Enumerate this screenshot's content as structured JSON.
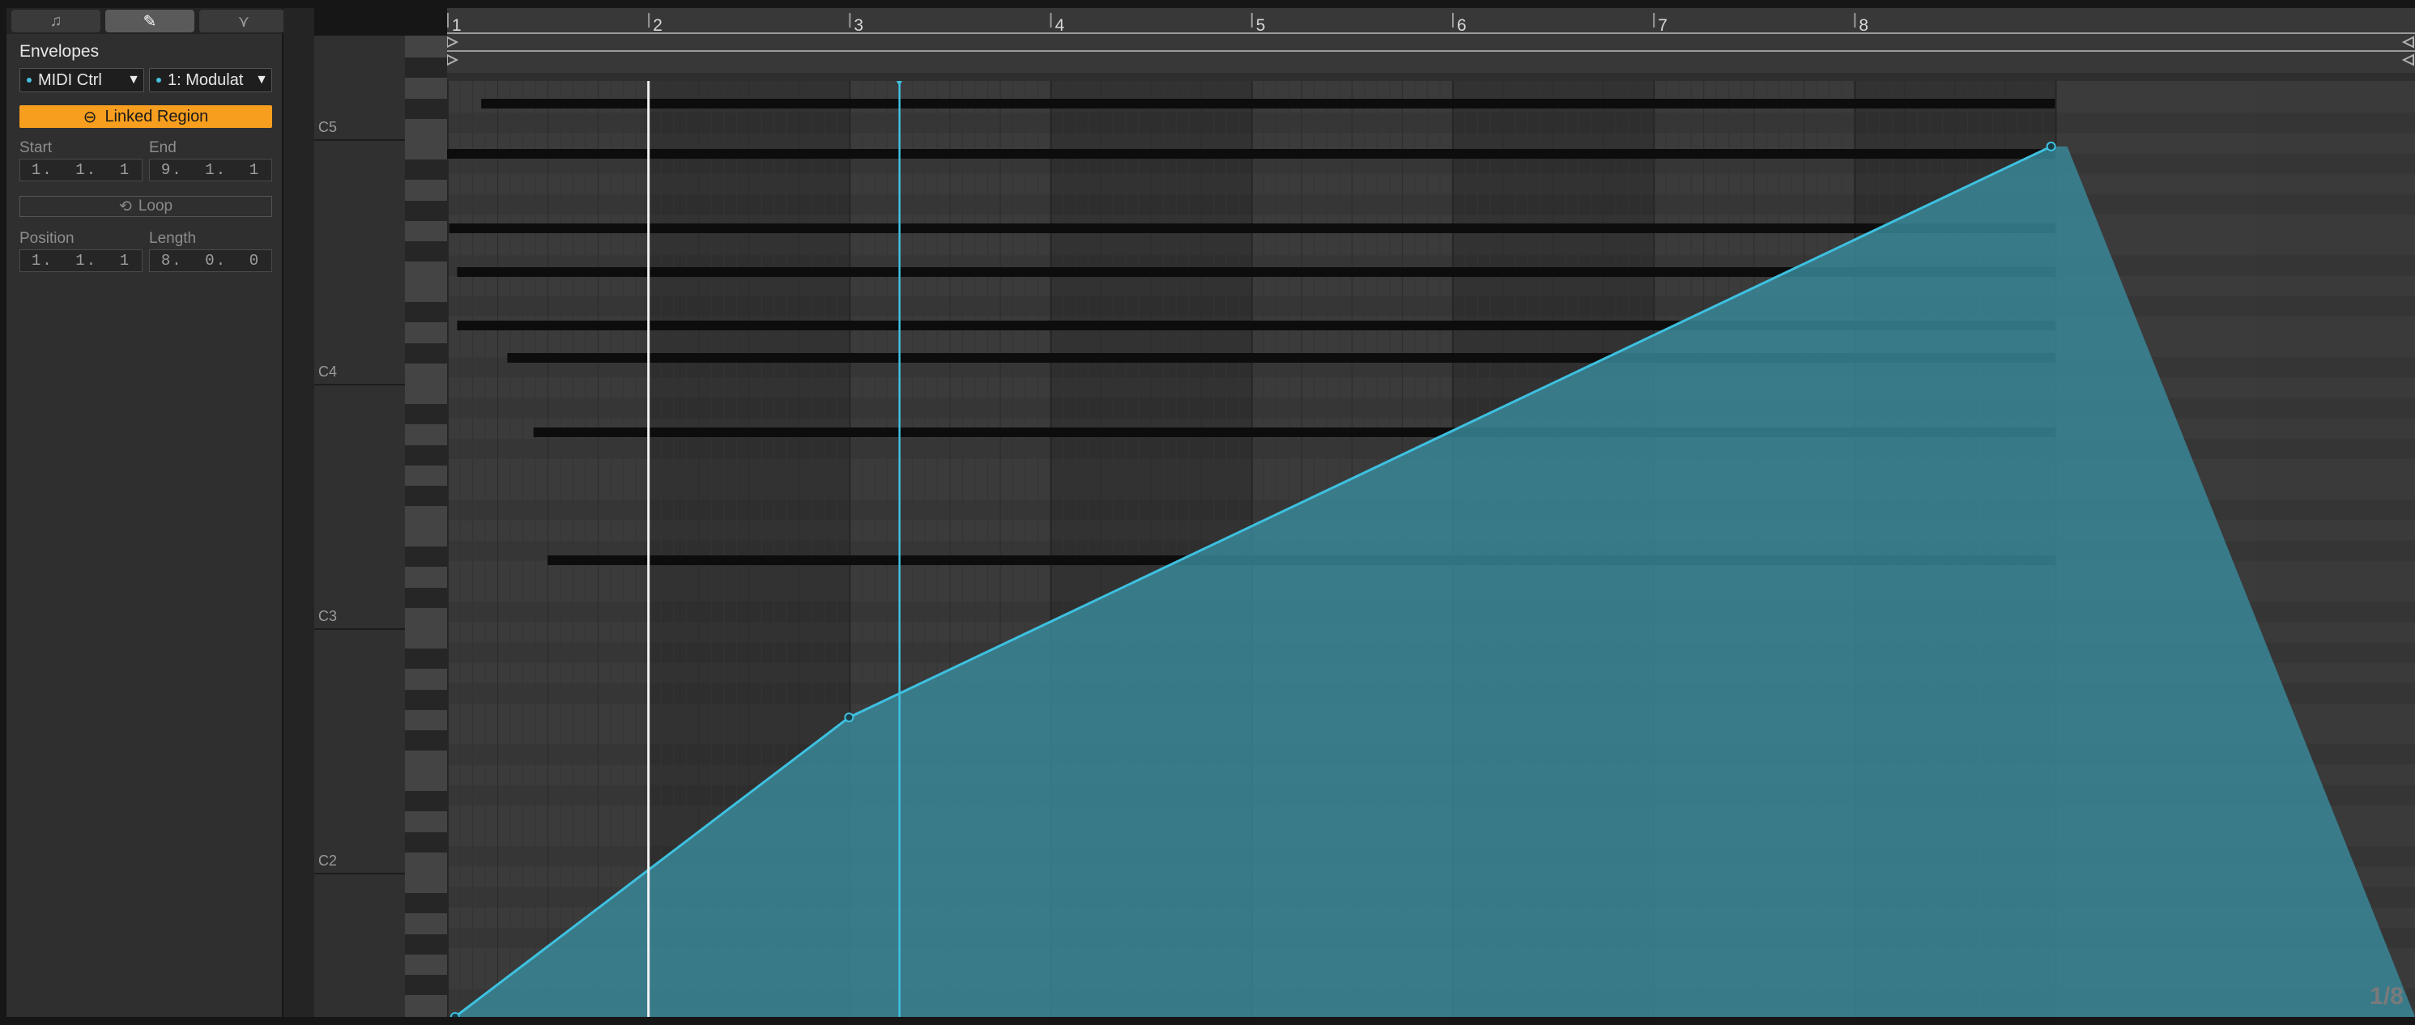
{
  "tabs": [
    {
      "name": "notes-tab",
      "icon": "note-icon",
      "glyph": "♫"
    },
    {
      "name": "envelopes-tab",
      "icon": "envelope-pencil-icon",
      "glyph": "✎"
    },
    {
      "name": "mpe-tab",
      "icon": "mpe-icon",
      "glyph": "⋎"
    }
  ],
  "panel": {
    "title": "Envelopes",
    "device_select": "MIDI Ctrl",
    "control_select": "1: Modulat",
    "linked_label": "Linked Region",
    "start_label": "Start",
    "end_label": "End",
    "start_value": [
      "1.",
      "1.",
      "1"
    ],
    "end_value": [
      "9.",
      "1.",
      "1"
    ],
    "loop_label": "Loop",
    "position_label": "Position",
    "length_label": "Length",
    "position_value": [
      "1.",
      "1.",
      "1"
    ],
    "length_value": [
      "8.",
      "0.",
      "0"
    ]
  },
  "keyboard": {
    "labels": [
      "C5",
      "C4",
      "C3",
      "C2"
    ]
  },
  "ruler": {
    "bars": [
      "1",
      "2",
      "3",
      "4",
      "5",
      "6",
      "7",
      "8"
    ]
  },
  "notes": [
    {
      "start": 1.17,
      "end": 9.0
    },
    {
      "start": 1.0,
      "end": 9.0
    },
    {
      "start": 1.01,
      "end": 9.0
    },
    {
      "start": 1.05,
      "end": 9.0
    },
    {
      "start": 1.05,
      "end": 9.0
    },
    {
      "start": 1.3,
      "end": 9.0
    },
    {
      "start": 1.43,
      "end": 9.0
    },
    {
      "start": 1.5,
      "end": 9.0
    }
  ],
  "envelope": {
    "color": "#3ec1e0",
    "fill": "#3a8a9c",
    "points": [
      [
        1.04,
        0.0
      ],
      [
        3.0,
        0.32
      ],
      [
        8.98,
        0.93
      ]
    ]
  },
  "playhead": {
    "position": 3.25,
    "color": "#3ec1e0"
  },
  "cursor": {
    "position": 2.0
  },
  "page_indicator": "1/8",
  "colors": {
    "accent": "#f79e1e",
    "envelope": "#3ec1e0",
    "note": "#0d0d0d"
  }
}
